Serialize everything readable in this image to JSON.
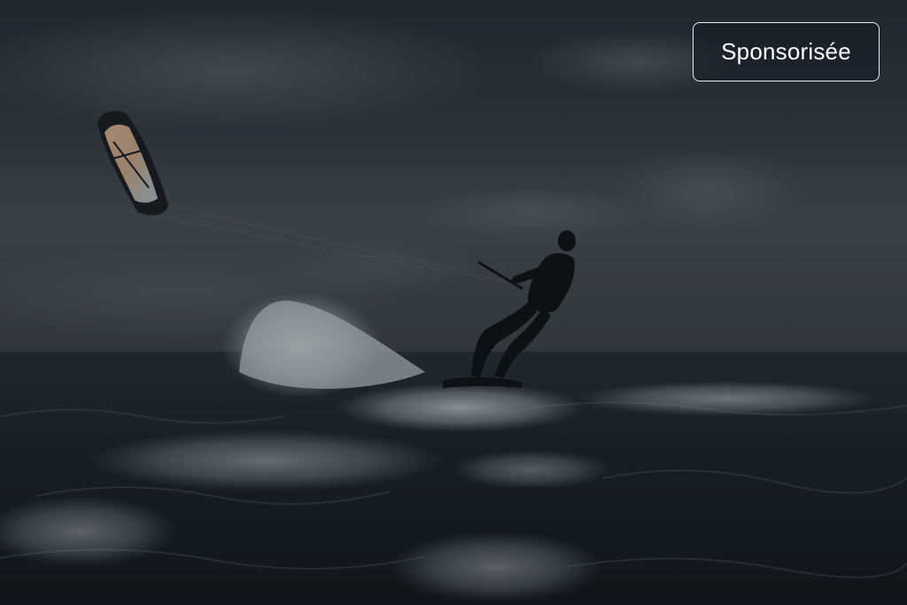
{
  "ad": {
    "badge_label": "Sponsorisée"
  },
  "photo": {
    "subject_icon": "kitesurfer-photo",
    "kite_icon": "kite-icon",
    "colors": {
      "sky_top": "#2b3440",
      "sky_horizon": "#4a535b",
      "sea_dark": "#1c252d",
      "spray": "#c9d1d6"
    }
  }
}
